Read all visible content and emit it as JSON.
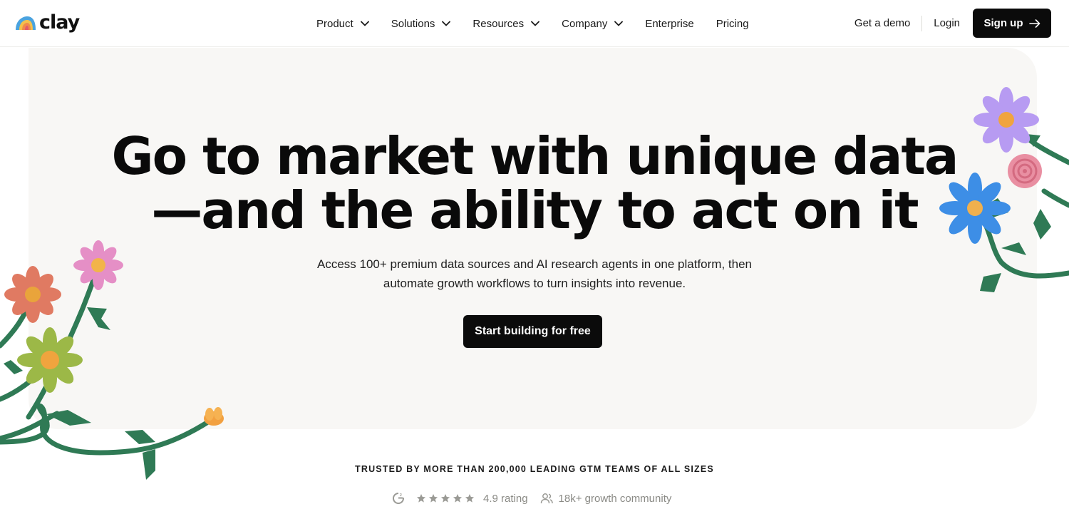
{
  "brand": {
    "name": "clay",
    "logo_icon": "rainbow-logo-icon"
  },
  "nav": {
    "items": [
      {
        "label": "Product",
        "has_dropdown": true
      },
      {
        "label": "Solutions",
        "has_dropdown": true
      },
      {
        "label": "Resources",
        "has_dropdown": true
      },
      {
        "label": "Company",
        "has_dropdown": true
      },
      {
        "label": "Enterprise",
        "has_dropdown": false
      },
      {
        "label": "Pricing",
        "has_dropdown": false
      }
    ],
    "get_demo": "Get a demo",
    "login": "Login",
    "signup": "Sign up",
    "signup_icon": "arrow-right-icon"
  },
  "hero": {
    "headline_line1": "Go to market with unique data",
    "headline_line2": "—and the ability to act on it",
    "subtext_line1": "Access 100+ premium data sources and AI research agents in one platform, then",
    "subtext_line2": "automate growth workflows to turn insights into revenue.",
    "cta": "Start building for free"
  },
  "social_proof": {
    "trusted": "TRUSTED BY MORE THAN 200,000 LEADING GTM TEAMS OF ALL SIZES",
    "g2_icon": "g2-logo-icon",
    "stars": 5,
    "rating": "4.9 rating",
    "community_icon": "people-icon",
    "community": "18k+ growth community"
  },
  "colors": {
    "background": "#ffffff",
    "hero_background": "#f8f7f5",
    "button": "#0b0b0b",
    "muted_text": "#8a8a85",
    "stem_green": "#2f7a55"
  }
}
